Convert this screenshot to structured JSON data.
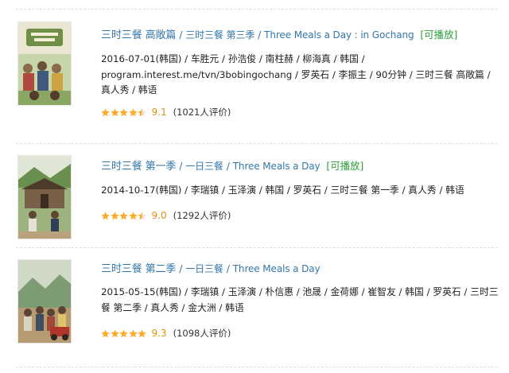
{
  "colors": {
    "link": "#3377aa",
    "playable": "#2c9f3a",
    "star": "#ffac2d",
    "star_empty": "#e4e4e4",
    "score": "#e09015"
  },
  "items": [
    {
      "title_main": "三时三餐 高敞篇",
      "title_sub": "三时三餐 第三季",
      "title_en": "Three Meals a Day : in Gochang",
      "playable": "[可播放]",
      "meta": "2016-07-01(韩国) / 车胜元 / 孙浩俊 / 南柱赫 / 柳海真 / 韩国 / program.interest.me/tvn/3bobingochang / 罗英石 / 李振主 / 90分钟 / 三时三餐 高敞篇 / 真人秀 / 韩语",
      "stars": 4.5,
      "score": "9.1",
      "votes": "(1021人评价)",
      "poster_icon": "poster-gochang"
    },
    {
      "title_main": "三时三餐 第一季",
      "title_sub": "一日三餐",
      "title_en": "Three Meals a Day",
      "playable": "[可播放]",
      "meta": "2014-10-17(韩国) / 李瑞镇 / 玉泽演 / 韩国 / 罗英石 / 三时三餐 第一季 / 真人秀 / 韩语",
      "stars": 4.5,
      "score": "9.0",
      "votes": "(1292人评价)",
      "poster_icon": "poster-season1"
    },
    {
      "title_main": "三时三餐 第二季",
      "title_sub": "一日三餐",
      "title_en": "Three Meals a Day",
      "playable": "",
      "meta": "2015-05-15(韩国) / 李瑞镇 / 玉泽演 / 朴信惠 / 池晟 / 金荷娜 / 崔智友 / 韩国 / 罗英石 / 三时三餐 第二季 / 真人秀 / 金大洲 / 韩语",
      "stars": 5,
      "score": "9.3",
      "votes": "(1098人评价)",
      "poster_icon": "poster-season2"
    }
  ]
}
